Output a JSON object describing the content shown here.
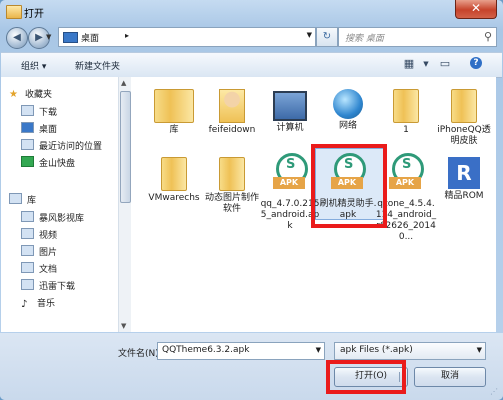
{
  "window": {
    "title": "打开",
    "close": "✕"
  },
  "address": {
    "location": "桌面",
    "arrow": "▸",
    "search_placeholder": "搜索 桌面"
  },
  "toolbar": {
    "organize": "组织 ▾",
    "new_folder": "新建文件夹",
    "help": "?"
  },
  "sidebar": {
    "favorites": "收藏夹",
    "favorites_items": [
      "下载",
      "桌面",
      "最近访问的位置",
      "金山快盘"
    ],
    "libraries": "库",
    "library_items": [
      "暴风影视库",
      "视频",
      "图片",
      "文档",
      "迅雷下载",
      "音乐"
    ]
  },
  "files": [
    {
      "label": "库",
      "icon": "library-folder-icon"
    },
    {
      "label": "feifeidown",
      "icon": "user-folder-icon"
    },
    {
      "label": "计算机",
      "icon": "computer-icon"
    },
    {
      "label": "网络",
      "icon": "network-icon"
    },
    {
      "label": "1",
      "icon": "folder-icon"
    },
    {
      "label": "iPhoneQQ透明皮肤",
      "icon": "folder-icon"
    },
    {
      "label": "VMwarechs",
      "icon": "folder-icon"
    },
    {
      "label": "动态图片制作软件",
      "icon": "folder-icon"
    },
    {
      "label": "qq_4.7.0.2155_android.apk",
      "icon": "apk-icon"
    },
    {
      "label": "刷机精灵助手.apk",
      "icon": "apk-icon"
    },
    {
      "label": "qzone_4.5.4.114_android_r62626_20140...",
      "icon": "apk-icon"
    },
    {
      "label": "精品ROM",
      "icon": "rom-shortcut-icon"
    }
  ],
  "apk_badge": "APK",
  "bottom": {
    "filename_label": "文件名(N):",
    "filename_value": "QQTheme6.3.2.apk",
    "filetype_value": "apk Files (*.apk)",
    "open_label": "打开(O)",
    "cancel_label": "取消"
  },
  "colors": {
    "highlight": "#ea1b1b",
    "selection": "#dce9f8",
    "accent": "#3a78c8"
  }
}
